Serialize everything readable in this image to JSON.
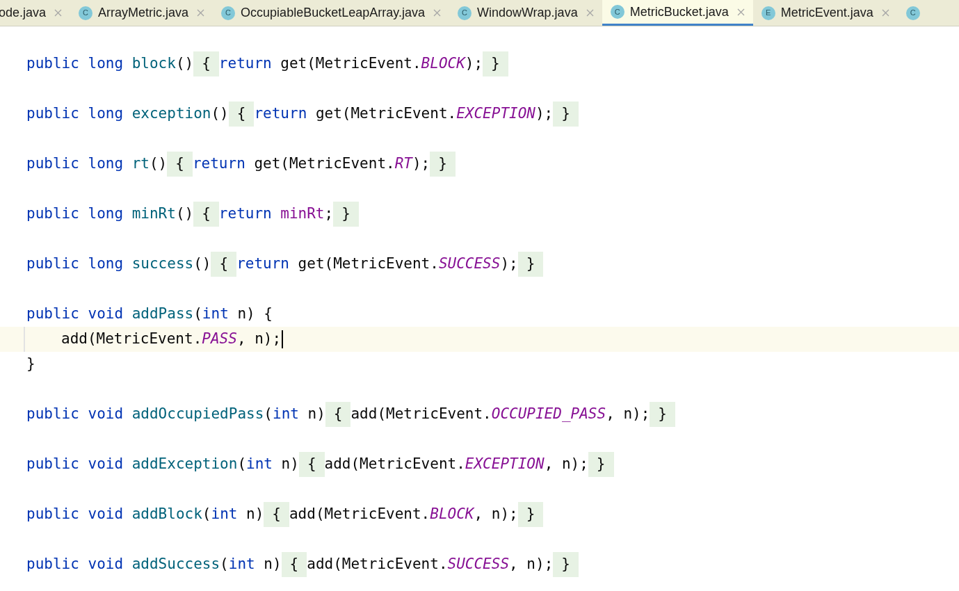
{
  "tabs": [
    {
      "label": "ode.java",
      "selected": false
    },
    {
      "icon": "C",
      "label": "ArrayMetric.java",
      "selected": false
    },
    {
      "icon": "C",
      "label": "OccupiableBucketLeapArray.java",
      "selected": false
    },
    {
      "icon": "C",
      "label": "WindowWrap.java",
      "selected": false
    },
    {
      "icon": "C",
      "label": "MetricBucket.java",
      "selected": true
    },
    {
      "icon": "E",
      "label": "MetricEvent.java",
      "selected": false
    },
    {
      "icon": "C",
      "selected": false
    }
  ],
  "lines": [
    {
      "kind": "blank"
    },
    {
      "kind": "code",
      "tokens": [
        {
          "kind": "kw",
          "text": "public long"
        },
        {
          "kind": "decl",
          "text": "block"
        },
        {
          "kind": "text",
          "text": "()"
        },
        {
          "kind": "fold",
          "text": "{"
        },
        {
          "kind": "kw",
          "text": "return"
        },
        {
          "kind": "text",
          "text": "get(MetricEvent."
        },
        {
          "kind": "const",
          "text": "BLOCK"
        },
        {
          "kind": "text",
          "text": ");"
        },
        {
          "kind": "fold",
          "text": "}"
        }
      ]
    },
    {
      "kind": "blank"
    },
    {
      "kind": "code",
      "tokens": [
        {
          "kind": "kw",
          "text": "public long"
        },
        {
          "kind": "decl",
          "text": "exception"
        },
        {
          "kind": "text",
          "text": "()"
        },
        {
          "kind": "fold",
          "text": "{"
        },
        {
          "kind": "kw",
          "text": "return"
        },
        {
          "kind": "text",
          "text": "get(MetricEvent."
        },
        {
          "kind": "const",
          "text": "EXCEPTION"
        },
        {
          "kind": "text",
          "text": ");"
        },
        {
          "kind": "fold",
          "text": "}"
        }
      ]
    },
    {
      "kind": "blank"
    },
    {
      "kind": "code",
      "tokens": [
        {
          "kind": "kw",
          "text": "public long"
        },
        {
          "kind": "decl",
          "text": "rt"
        },
        {
          "kind": "text",
          "text": "()"
        },
        {
          "kind": "fold",
          "text": "{"
        },
        {
          "kind": "kw",
          "text": "return"
        },
        {
          "kind": "text",
          "text": "get(MetricEvent."
        },
        {
          "kind": "const",
          "text": "RT"
        },
        {
          "kind": "text",
          "text": ");"
        },
        {
          "kind": "fold",
          "text": "}"
        }
      ]
    },
    {
      "kind": "blank"
    },
    {
      "kind": "code",
      "tokens": [
        {
          "kind": "kw",
          "text": "public long"
        },
        {
          "kind": "decl",
          "text": "minRt"
        },
        {
          "kind": "text",
          "text": "()"
        },
        {
          "kind": "fold",
          "text": "{"
        },
        {
          "kind": "kw",
          "text": "return"
        },
        {
          "kind": "field",
          "text": "minRt"
        },
        {
          "kind": "text",
          "text": ";"
        },
        {
          "kind": "fold",
          "text": "}"
        }
      ]
    },
    {
      "kind": "blank"
    },
    {
      "kind": "code",
      "tokens": [
        {
          "kind": "kw",
          "text": "public long"
        },
        {
          "kind": "decl",
          "text": "success"
        },
        {
          "kind": "text",
          "text": "()"
        },
        {
          "kind": "fold",
          "text": "{"
        },
        {
          "kind": "kw",
          "text": "return"
        },
        {
          "kind": "text",
          "text": "get(MetricEvent."
        },
        {
          "kind": "const",
          "text": "SUCCESS"
        },
        {
          "kind": "text",
          "text": ");"
        },
        {
          "kind": "fold",
          "text": "}"
        }
      ]
    },
    {
      "kind": "blank"
    },
    {
      "kind": "code",
      "tokens": [
        {
          "kind": "kw",
          "text": "public void"
        },
        {
          "kind": "decl",
          "text": "addPass"
        },
        {
          "kind": "text",
          "text": "("
        },
        {
          "kind": "kw",
          "text": "int"
        },
        {
          "kind": "text",
          "text": "n) {"
        }
      ]
    },
    {
      "kind": "body",
      "current": true,
      "tokens": [
        {
          "kind": "text",
          "text": "add(MetricEvent."
        },
        {
          "kind": "const",
          "text": "PASS"
        },
        {
          "kind": "text",
          "text": ", n);"
        }
      ]
    },
    {
      "kind": "code",
      "tokens": [
        {
          "kind": "text",
          "text": "}"
        }
      ]
    },
    {
      "kind": "blank"
    },
    {
      "kind": "code",
      "tokens": [
        {
          "kind": "kw",
          "text": "public void"
        },
        {
          "kind": "decl",
          "text": "addOccupiedPass"
        },
        {
          "kind": "text",
          "text": "("
        },
        {
          "kind": "kw",
          "text": "int"
        },
        {
          "kind": "text",
          "text": "n)"
        },
        {
          "kind": "fold",
          "text": "{"
        },
        {
          "kind": "text",
          "text": "add(MetricEvent."
        },
        {
          "kind": "const",
          "text": "OCCUPIED_PASS"
        },
        {
          "kind": "text",
          "text": ", n);"
        },
        {
          "kind": "fold",
          "text": "}"
        }
      ]
    },
    {
      "kind": "blank"
    },
    {
      "kind": "code",
      "tokens": [
        {
          "kind": "kw",
          "text": "public void"
        },
        {
          "kind": "decl",
          "text": "addException"
        },
        {
          "kind": "text",
          "text": "("
        },
        {
          "kind": "kw",
          "text": "int"
        },
        {
          "kind": "text",
          "text": "n)"
        },
        {
          "kind": "fold",
          "text": "{"
        },
        {
          "kind": "text",
          "text": "add(MetricEvent."
        },
        {
          "kind": "const",
          "text": "EXCEPTION"
        },
        {
          "kind": "text",
          "text": ", n);"
        },
        {
          "kind": "fold",
          "text": "}"
        }
      ]
    },
    {
      "kind": "blank"
    },
    {
      "kind": "code",
      "tokens": [
        {
          "kind": "kw",
          "text": "public void"
        },
        {
          "kind": "decl",
          "text": "addBlock"
        },
        {
          "kind": "text",
          "text": "("
        },
        {
          "kind": "kw",
          "text": "int"
        },
        {
          "kind": "text",
          "text": "n)"
        },
        {
          "kind": "fold",
          "text": "{"
        },
        {
          "kind": "text",
          "text": "add(MetricEvent."
        },
        {
          "kind": "const",
          "text": "BLOCK"
        },
        {
          "kind": "text",
          "text": ", n);"
        },
        {
          "kind": "fold",
          "text": "}"
        }
      ]
    },
    {
      "kind": "blank"
    },
    {
      "kind": "code",
      "tokens": [
        {
          "kind": "kw",
          "text": "public void"
        },
        {
          "kind": "decl",
          "text": "addSuccess"
        },
        {
          "kind": "text",
          "text": "("
        },
        {
          "kind": "kw",
          "text": "int"
        },
        {
          "kind": "text",
          "text": "n)"
        },
        {
          "kind": "fold",
          "text": "{"
        },
        {
          "kind": "text",
          "text": "add(MetricEvent."
        },
        {
          "kind": "const",
          "text": "SUCCESS"
        },
        {
          "kind": "text",
          "text": ", n);"
        },
        {
          "kind": "fold",
          "text": "}"
        }
      ]
    }
  ]
}
